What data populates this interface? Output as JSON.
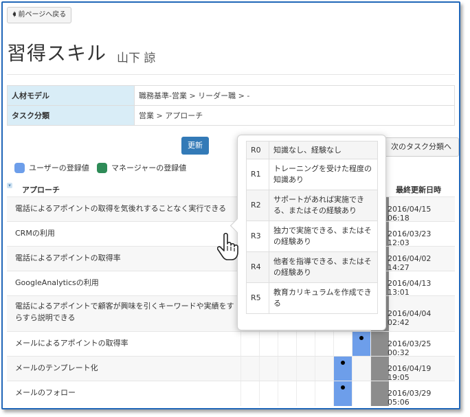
{
  "back_button": {
    "label": "前ページへ戻る",
    "icon": "arrow-left-icon"
  },
  "title": "習得スキル",
  "user_name": "山下 諒",
  "info": [
    {
      "key": "人材モデル",
      "value": "職務基準-営業 > リーダー職 > -"
    },
    {
      "key": "タスク分類",
      "value": "営業 > アプローチ"
    }
  ],
  "update_button": "更新",
  "next_button": "次のタスク分類へ",
  "legend": {
    "user": {
      "label": "ユーザーの登録値",
      "color": "#6d9eea"
    },
    "manager": {
      "label": "マネージャーの登録値",
      "color": "#2e8b57"
    }
  },
  "table_head": {
    "category": "アプローチ",
    "last_updated": "最終更新日時"
  },
  "rows": [
    {
      "label": "電話によるアポイントの取得を気後れすることなく実行できる",
      "date": "2016/04/15 06:18"
    },
    {
      "label": "CRMの利用",
      "date": "2016/03/23 12:03"
    },
    {
      "label": "電話によるアポイントの取得率",
      "date": "2016/04/02 14:27"
    },
    {
      "label": "GoogleAnalyticsの利用",
      "date": "2016/04/13 13:01"
    },
    {
      "label": "電話によるアポイントで顧客が興味を引くキーワードや実績をすらすら説明できる",
      "date": "2016/04/04 02:42"
    },
    {
      "label": "メールによるアポイントの取得率",
      "date": "2016/03/25 00:32"
    },
    {
      "label": "メールのテンプレート化",
      "date": "2016/04/19 19:05"
    },
    {
      "label": "メールのフォロー",
      "date": "2016/03/29 05:06"
    }
  ],
  "levels": [
    {
      "code": "R0",
      "desc": "知識なし、経験なし"
    },
    {
      "code": "R1",
      "desc": "トレーニングを受けた程度の知識あり"
    },
    {
      "code": "R2",
      "desc": "サポートがあれば実施できる、またはその経験あり"
    },
    {
      "code": "R3",
      "desc": "独力で実施できる、またはその経験あり"
    },
    {
      "code": "R4",
      "desc": "他者を指導できる、またはその経験あり"
    },
    {
      "code": "R5",
      "desc": "教育カリキュラムを作成できる"
    }
  ],
  "visible_ratings": [
    {
      "row": 5,
      "user": 6
    },
    {
      "row": 6,
      "user": 5
    },
    {
      "row": 7,
      "user": 5
    }
  ]
}
